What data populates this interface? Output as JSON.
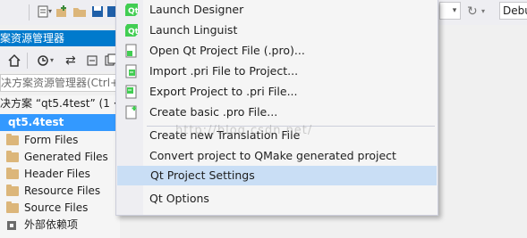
{
  "toolbar": {
    "config_value": "Debu"
  },
  "solution_explorer": {
    "title": "案资源管理器",
    "search_placeholder": "决方案资源管理器(Ctrl+",
    "solution_line": "决方案 “qt5.4test” (1 ·",
    "project": "qt5.4test",
    "items": [
      {
        "label": "Form Files"
      },
      {
        "label": "Generated Files"
      },
      {
        "label": "Header Files"
      },
      {
        "label": "Resource Files"
      },
      {
        "label": "Source Files"
      },
      {
        "label": "外部依赖项"
      }
    ]
  },
  "menu": {
    "items": [
      {
        "label": "Launch Designer"
      },
      {
        "label": "Launch Linguist"
      },
      {
        "label": "Open Qt Project File (.pro)..."
      },
      {
        "label": "Import .pri File to Project..."
      },
      {
        "label": "Export Project to .pri File..."
      },
      {
        "label": "Create basic .pro File..."
      },
      {
        "label": "Create new Translation File"
      },
      {
        "label": "Convert project to QMake generated project"
      },
      {
        "label": "Qt Project Settings"
      },
      {
        "label": "Qt Options"
      }
    ],
    "highlighted_item": "Qt Project Settings"
  },
  "watermark": "http://blog.csdn.net/",
  "colors": {
    "accent": "#007acc",
    "selection": "#3399ff",
    "menu_highlight": "#c9def5",
    "qt_green": "#41cd52"
  }
}
